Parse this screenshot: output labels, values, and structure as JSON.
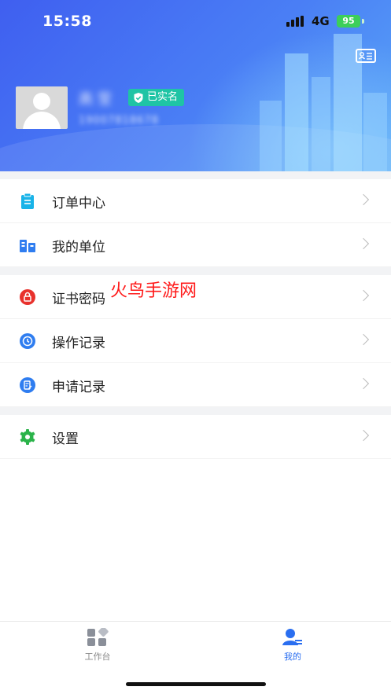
{
  "status": {
    "time": "15:58",
    "network": "4G",
    "battery": "95"
  },
  "profile": {
    "name": "高 莹",
    "phone": "19007818678",
    "verified_label": "已实名"
  },
  "menu": {
    "order_center": "订单中心",
    "my_unit": "我的单位",
    "cert_password": "证书密码",
    "operation_log": "操作记录",
    "apply_log": "申请记录",
    "settings": "设置"
  },
  "watermark": "火鸟手游网",
  "tabs": {
    "workbench": "工作台",
    "mine": "我的"
  },
  "colors": {
    "accent": "#2a6ef0",
    "verified": "#1fc4a5",
    "header": "#4a7ff5"
  }
}
